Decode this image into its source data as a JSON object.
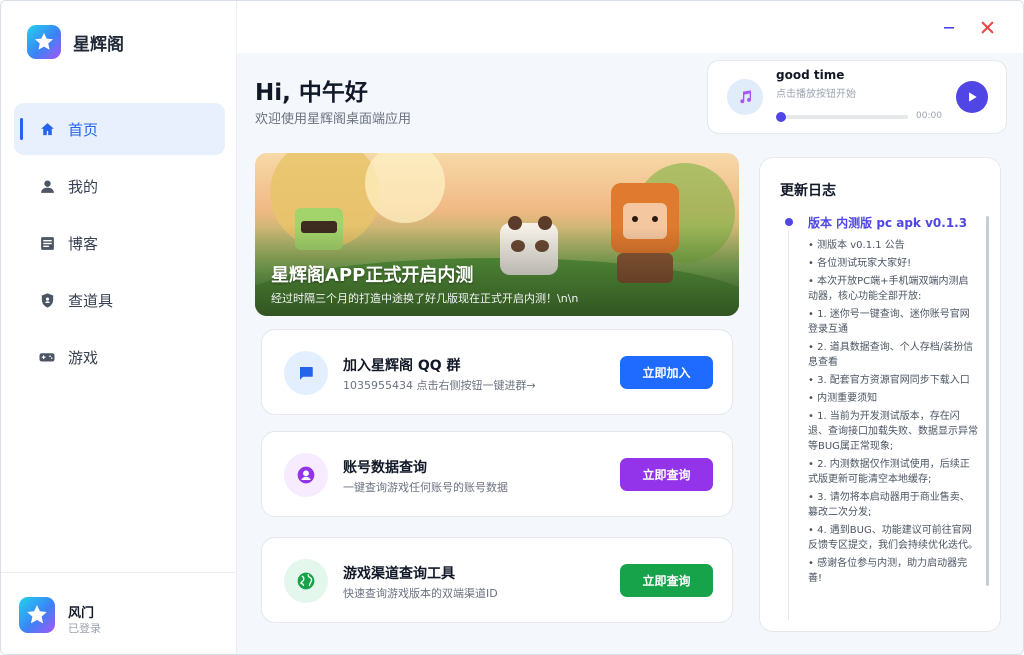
{
  "app": {
    "name": "星辉阁"
  },
  "sidebar": {
    "items": [
      {
        "label": "首页",
        "icon": "home-icon",
        "active": true
      },
      {
        "label": "我的",
        "icon": "user-icon",
        "active": false
      },
      {
        "label": "博客",
        "icon": "blog-icon",
        "active": false
      },
      {
        "label": "查道具",
        "icon": "shield-icon",
        "active": false
      },
      {
        "label": "游戏",
        "icon": "gamepad-icon",
        "active": false
      }
    ],
    "user": {
      "name": "风门",
      "status": "已登录"
    }
  },
  "greeting": {
    "title": "Hi, 中午好",
    "subtitle": "欢迎使用星辉阁桌面端应用"
  },
  "player": {
    "title": "good time",
    "subtitle": "点击播放按钮开始",
    "time": "00:00",
    "progress": 0
  },
  "banner": {
    "title": "星辉阁APP正式开启内测",
    "subtitle": "经过时隔三个月的打造中途换了好几版现在正式开启内测！\\n\\n"
  },
  "cards": [
    {
      "title": "加入星辉阁 QQ 群",
      "subtitle": "1035955434 点击右侧按钮一键进群→",
      "button": "立即加入",
      "color": "#1f6bff"
    },
    {
      "title": "账号数据查询",
      "subtitle": "一键查询游戏任何账号的账号数据",
      "button": "立即查询",
      "color": "#9333ea"
    },
    {
      "title": "游戏渠道查询工具",
      "subtitle": "快速查询游戏版本的双端渠道ID",
      "button": "立即查询",
      "color": "#16a34a"
    }
  ],
  "changelog": {
    "title": "更新日志",
    "version": "版本 内测版 pc apk v0.1.3",
    "items": [
      "• 测版本 v0.1.1 公告",
      "• 各位测试玩家大家好!",
      "• 本次开放PC端+手机端双端内测启动器，核心功能全部开放:",
      "• 1. 迷你号一键查询、迷你账号官网登录互通",
      "• 2. 道具数据查询、个人存档/装扮信息查看",
      "• 3. 配套官方资源官网同步下载入口",
      "• 内测重要须知",
      "• 1. 当前为开发测试版本，存在闪退、查询接口加载失败、数据显示异常等BUG属正常现象;",
      "• 2. 内测数据仅作测试使用，后续正式版更新可能清空本地缓存;",
      "• 3. 请勿将本启动器用于商业售卖、篡改二次分发;",
      "• 4. 遇到BUG、功能建议可前往官网反馈专区提交，我们会持续优化迭代。",
      "• 感谢各位参与内测，助力启动器完善!"
    ]
  }
}
